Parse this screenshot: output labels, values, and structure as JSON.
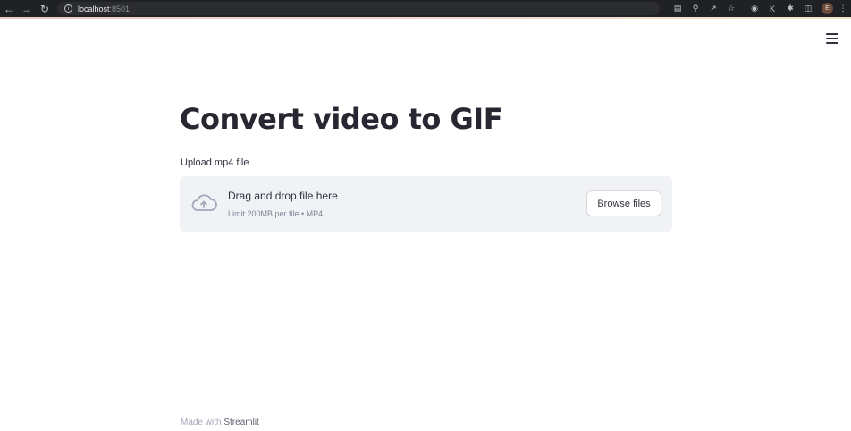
{
  "browser": {
    "url_host": "localhost",
    "url_port": ":8501",
    "profile_initial": "E"
  },
  "page": {
    "title": "Convert video to GIF",
    "uploader": {
      "label": "Upload mp4 file",
      "drop_text": "Drag and drop file here",
      "limit_text": "Limit 200MB per file • MP4",
      "browse_label": "Browse files"
    },
    "footer": {
      "prefix": "Made with ",
      "brand": "Streamlit"
    }
  },
  "colors": {
    "chrome_bg": "#202124",
    "title": "#262730",
    "dropzone_bg": "#f0f2f6"
  }
}
